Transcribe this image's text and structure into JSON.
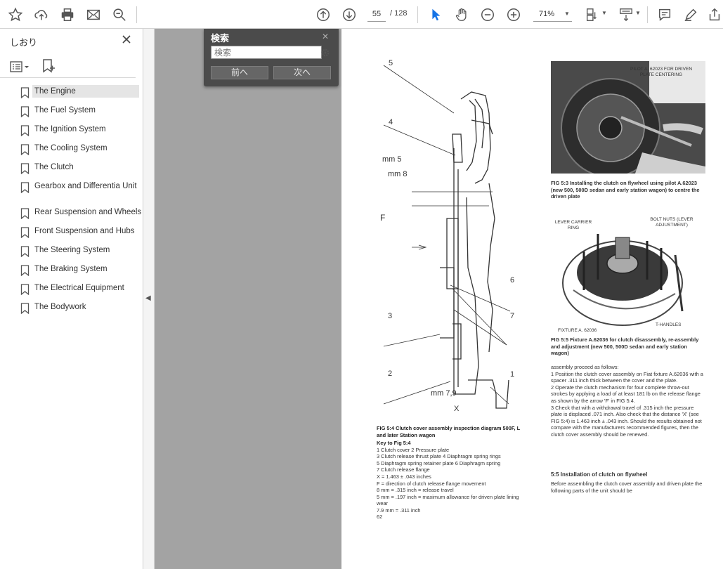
{
  "toolbar": {
    "icons": [
      "star-icon",
      "upload-icon",
      "print-icon",
      "mail-icon",
      "zoom-search-icon",
      "page-up-icon",
      "page-down-icon",
      "select-cursor-icon",
      "hand-icon",
      "zoom-out-icon",
      "zoom-in-icon",
      "page-layout-icon",
      "scroll-mode-icon",
      "comment-icon",
      "pen-icon",
      "share-icon"
    ],
    "current_page": "55",
    "page_total": "/ 128",
    "zoom": "71%"
  },
  "sidebar": {
    "title": "しおり",
    "bookmarks": [
      {
        "label": "The Engine",
        "selected": true
      },
      {
        "label": "The Fuel System"
      },
      {
        "label": "The Ignition System"
      },
      {
        "label": "The Cooling System"
      },
      {
        "label": "The Clutch"
      },
      {
        "label": "Gearbox and Differentia Unit",
        "two_line": true
      },
      {
        "label": "Rear Suspension and Wheels"
      },
      {
        "label": "Front Suspension and Hubs"
      },
      {
        "label": "The Steering System"
      },
      {
        "label": "The Braking System"
      },
      {
        "label": "The Electrical Equipment"
      },
      {
        "label": "The Bodywork"
      }
    ]
  },
  "find": {
    "title": "検索",
    "placeholder": "検索",
    "prev_label": "前へ",
    "next_label": "次へ"
  },
  "document": {
    "fig_labels": {
      "n5": "5",
      "n4": "4",
      "mm5": "mm 5",
      "mm8": "mm 8",
      "F": "F",
      "n6": "6",
      "n3": "3",
      "n7": "7",
      "n2": "2",
      "n1": "1",
      "mm79": "mm 7,9",
      "X": "X"
    },
    "photo1_callout": "PILOT A. 62023 FOR DRIVEN PLATE CENTERING",
    "fig_5_3_caption": "FIG 5:3 Installing the clutch on flywheel using pilot A.62023 (new 500, 500D sedan and early station wagon) to centre the driven plate",
    "photo2_callouts": {
      "lever": "LEVER CARRIER RING",
      "bolt": "BOLT NUTS (LEVER ADJUSTMENT)",
      "fixture": "FIXTURE A. 62036",
      "handles": "T-HANDLES"
    },
    "fig_5_5_caption": "FIG 5:5 Fixture A.62036 for clutch disassembly, re-assembly and adjustment (new 500, 500D sedan and early station wagon)",
    "fig_5_4_caption": "FIG 5:4 Clutch cover assembly inspection diagram 500F, L and later Station wagon",
    "key_title": "Key to Fig 5:4",
    "key_lines": [
      "1 Clutch cover        2 Pressure plate",
      "3 Clutch release thrust plate   4 Diaphragm spring rings",
      "5 Diaphragm spring retainer plate   6 Diaphragm spring",
      "7 Clutch release flange",
      "X    = 1.463 ± .043 inches",
      "F    = direction of clutch release flange movement",
      "8 mm = .315 inch = release travel",
      "5 mm = .197 inch = maximum allowance for driven plate lining wear",
      "7.9 mm = .311 inch"
    ],
    "right_text": [
      "assembly proceed as follows:",
      "1 Position the clutch cover assembly on Fiat fixture A.62036 with a spacer .311 inch thick between the cover and the plate.",
      "2 Operate the clutch mechanism for four complete throw-out strokes by applying a load of at least 181 lb on the release flange as shown by the arrow 'F' in FIG 5:4.",
      "3 Check that with a withdrawal travel of .315 inch the pressure plate is displaced .071 inch. Also check that the distance 'X' (see FIG 5:4) is 1.463 inch ± .043 inch. Should the results obtained not compare with the manufacturers recommended figures, then the clutch cover assembly should be renewed."
    ],
    "section_heading": "5:5 Installation of clutch on flywheel",
    "section_text": "Before assembling the clutch cover assembly and driven plate the following parts of the unit should be",
    "page_number": "62"
  }
}
